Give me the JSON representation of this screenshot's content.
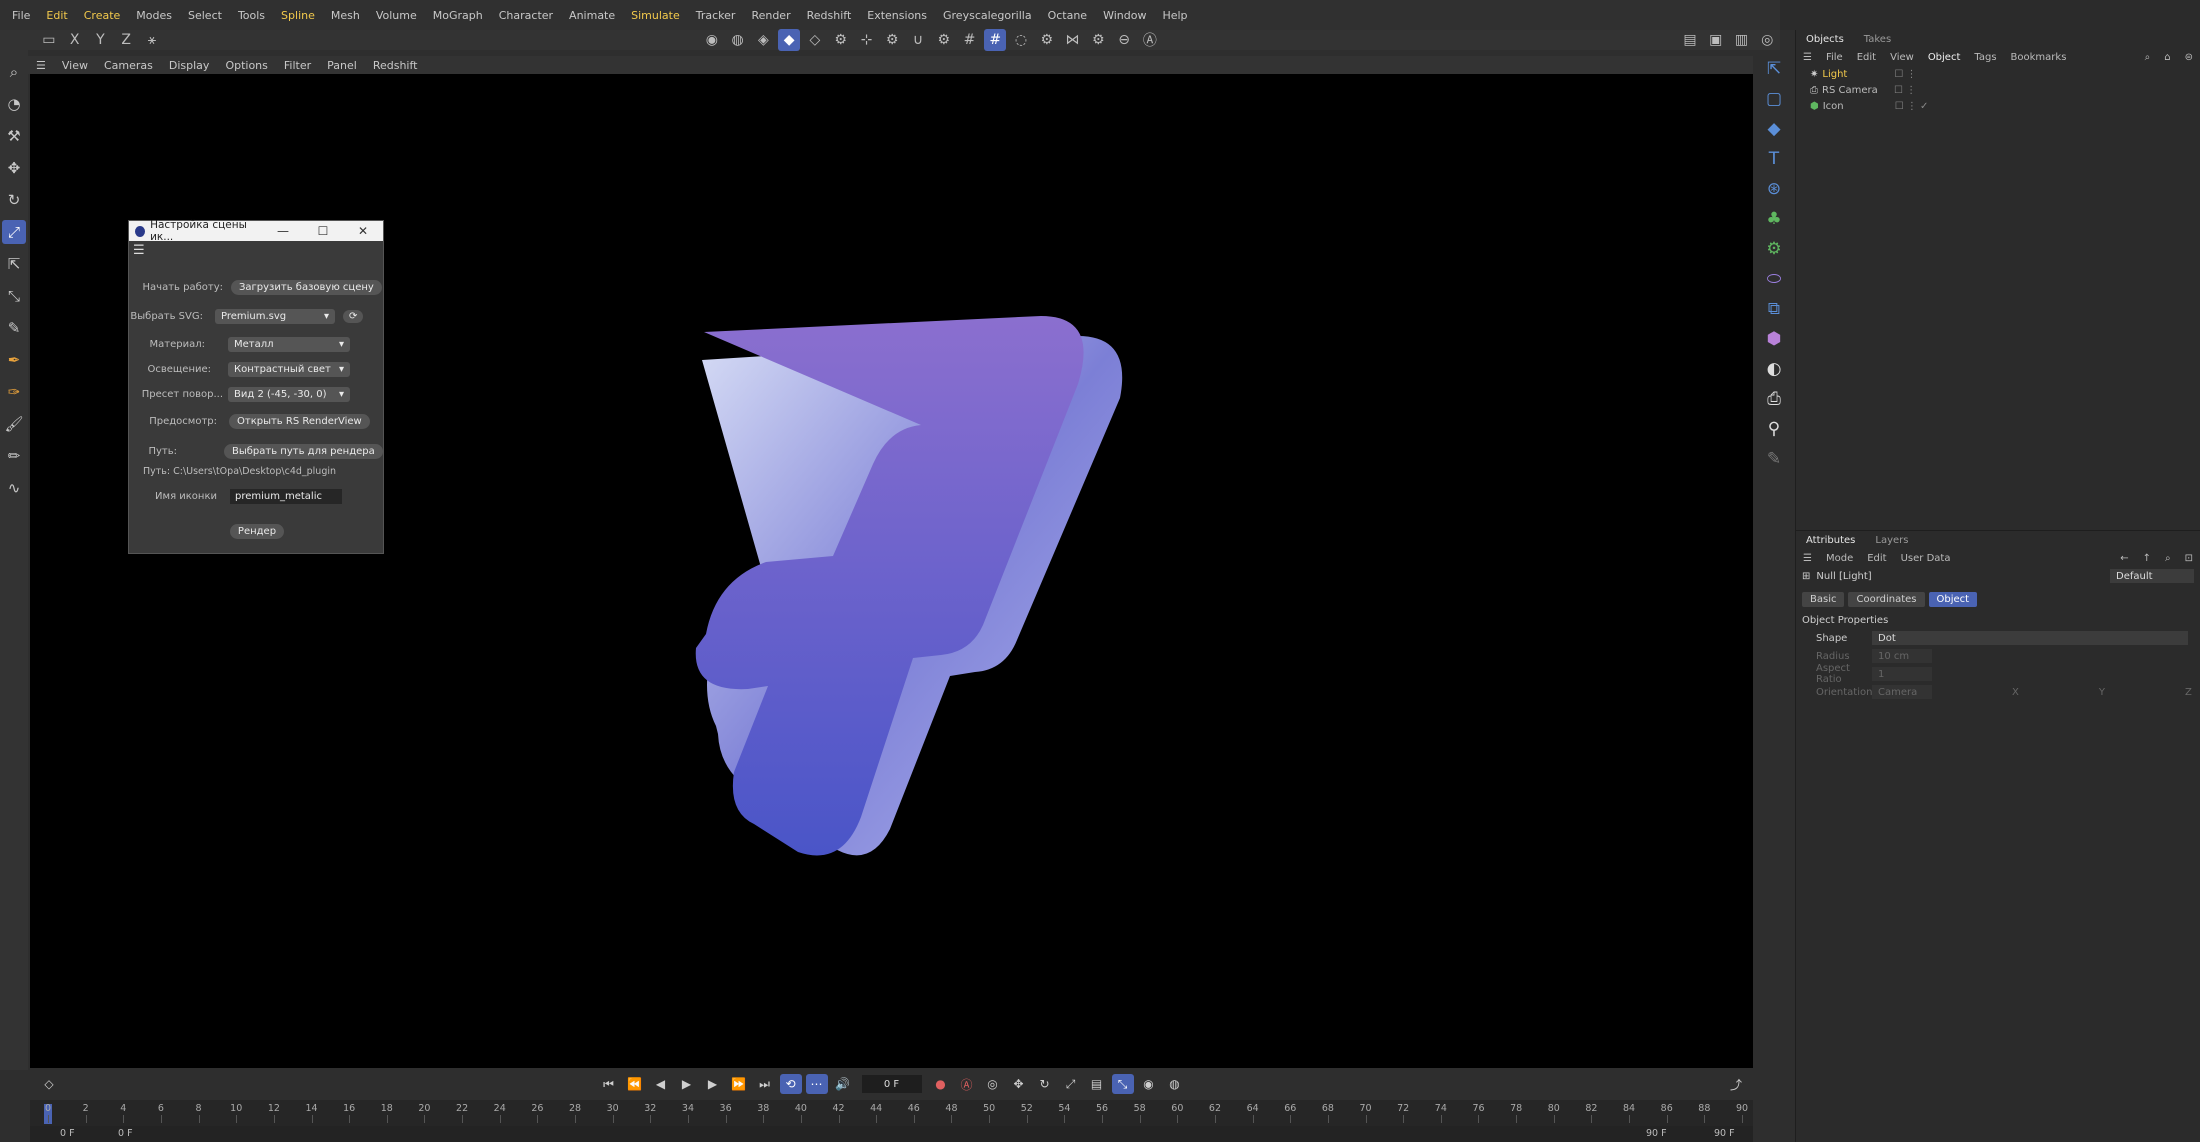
{
  "menubar": [
    "File",
    "Edit",
    "Create",
    "Modes",
    "Select",
    "Tools",
    "Spline",
    "Mesh",
    "Volume",
    "MoGraph",
    "Character",
    "Animate",
    "Simulate",
    "Tracker",
    "Render",
    "Redshift",
    "Extensions",
    "Greyscalegorilla",
    "Octane",
    "Window",
    "Help"
  ],
  "menubar_highlight": [
    "Edit",
    "Create",
    "Spline",
    "Simulate"
  ],
  "toolbar": {
    "axes": [
      "X",
      "Y",
      "Z"
    ]
  },
  "viewport_menu": [
    "View",
    "Cameras",
    "Display",
    "Options",
    "Filter",
    "Panel",
    "Redshift"
  ],
  "dialog": {
    "title": "Настройка сцены ик...",
    "start_label": "Начать работу:",
    "start_button": "Загрузить базовую сцену",
    "svg_label": "Выбрать SVG:",
    "svg_value": "Premium.svg",
    "material_label": "Материал:",
    "material_value": "Металл",
    "lighting_label": "Освещение:",
    "lighting_value": "Контрастный свет",
    "rotation_label": "Пресет повор...",
    "rotation_value": "Вид 2 (-45, -30, 0)",
    "preview_label": "Предосмотр:",
    "preview_button": "Открыть RS RenderView",
    "path_label": "Путь:",
    "path_button": "Выбрать путь для рендера",
    "path_value": "Путь: C:\\Users\\tOpa\\Desktop\\c4d_plugin",
    "icon_name_label": "Имя иконки",
    "icon_name_value": "premium_metalic",
    "render_button": "Рендер"
  },
  "objects_panel": {
    "tabs": [
      "Objects",
      "Takes"
    ],
    "menu": [
      "File",
      "Edit",
      "View",
      "Object",
      "Tags",
      "Bookmarks"
    ],
    "items": [
      {
        "name": "Light",
        "color": "#f2c94c"
      },
      {
        "name": "RS Camera",
        "color": "#bbbbbb"
      },
      {
        "name": "Icon",
        "color": "#bbbbbb"
      }
    ]
  },
  "attributes_panel": {
    "tabs": [
      "Attributes",
      "Layers"
    ],
    "menu": [
      "Mode",
      "Edit",
      "User Data"
    ],
    "object_name": "Null [Light]",
    "preset": "Default",
    "subtabs": [
      "Basic",
      "Coordinates",
      "Object"
    ],
    "section": "Object Properties",
    "props": [
      {
        "label": "Shape",
        "value": "Dot",
        "dim": false
      },
      {
        "label": "Radius",
        "value": "10 cm",
        "dim": true
      },
      {
        "label": "Aspect Ratio",
        "value": "1",
        "dim": true
      },
      {
        "label": "Orientation",
        "value": "Camera",
        "dim": true
      }
    ],
    "orientation_axes": [
      "X",
      "Y",
      "Z"
    ]
  },
  "timeline": {
    "current_frame": "0 F",
    "start_frame": "0 F",
    "min_frame": "0 F",
    "max_frame": "90 F",
    "end_frame": "90 F",
    "ticks": [
      "0",
      "2",
      "4",
      "6",
      "8",
      "10",
      "12",
      "14",
      "16",
      "18",
      "20",
      "22",
      "24",
      "26",
      "28",
      "30",
      "32",
      "34",
      "36",
      "38",
      "40",
      "42",
      "44",
      "46",
      "48",
      "50",
      "52",
      "54",
      "56",
      "58",
      "60",
      "62",
      "64",
      "66",
      "68",
      "70",
      "72",
      "74",
      "76",
      "78",
      "80",
      "82",
      "84",
      "86",
      "88",
      "90"
    ]
  },
  "colors": {
    "accent": "#4a63b3",
    "highlight": "#f2c94c",
    "viewport": "#000000",
    "shape_top": "#8b6fcf",
    "shape_bottom": "#4a55c8"
  }
}
